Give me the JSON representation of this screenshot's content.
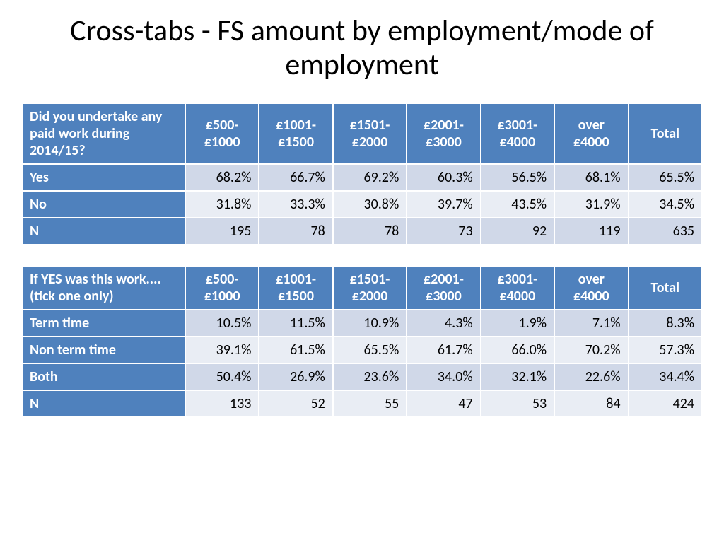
{
  "title": "Cross-tabs - FS amount by employment/mode of employment",
  "chart_data": [
    {
      "type": "table",
      "question": "Did you undertake any paid work during 2014/15?",
      "columns": [
        "£500-£1000",
        "£1001-£1500",
        "£1501-£2000",
        "£2001-£3000",
        "£3001-£4000",
        "over £4000",
        "Total"
      ],
      "rows": [
        {
          "label": "Yes",
          "values": [
            "68.2%",
            "66.7%",
            "69.2%",
            "60.3%",
            "56.5%",
            "68.1%",
            "65.5%"
          ]
        },
        {
          "label": "No",
          "values": [
            "31.8%",
            "33.3%",
            "30.8%",
            "39.7%",
            "43.5%",
            "31.9%",
            "34.5%"
          ]
        },
        {
          "label": "N",
          "values": [
            "195",
            "78",
            "78",
            "73",
            "92",
            "119",
            "635"
          ]
        }
      ]
    },
    {
      "type": "table",
      "question": "If YES was this work.... (tick one only)",
      "columns": [
        "£500-£1000",
        "£1001-£1500",
        "£1501-£2000",
        "£2001-£3000",
        "£3001-£4000",
        "over £4000",
        "Total"
      ],
      "rows": [
        {
          "label": "Term time",
          "values": [
            "10.5%",
            "11.5%",
            "10.9%",
            "4.3%",
            "1.9%",
            "7.1%",
            "8.3%"
          ]
        },
        {
          "label": "Non term time",
          "values": [
            "39.1%",
            "61.5%",
            "65.5%",
            "61.7%",
            "66.0%",
            "70.2%",
            "57.3%"
          ]
        },
        {
          "label": "Both",
          "values": [
            "50.4%",
            "26.9%",
            "23.6%",
            "34.0%",
            "32.1%",
            "22.6%",
            "34.4%"
          ]
        },
        {
          "label": "N",
          "values": [
            "133",
            "52",
            "55",
            "47",
            "53",
            "84",
            "424"
          ]
        }
      ]
    }
  ]
}
